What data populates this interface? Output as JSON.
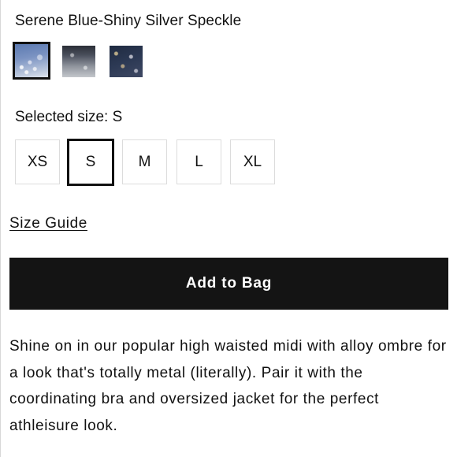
{
  "product": {
    "color_name": "Serene Blue-Shiny Silver Speckle",
    "swatches": [
      {
        "name": "Serene Blue-Shiny Silver Speckle",
        "selected": true,
        "color": "#7b93c2"
      },
      {
        "name": "",
        "selected": false,
        "color": "#6a6f7a"
      },
      {
        "name": "",
        "selected": false,
        "color": "#2c3954"
      }
    ],
    "selected_size_label": "Selected size: S",
    "sizes": [
      {
        "label": "XS",
        "selected": false
      },
      {
        "label": "S",
        "selected": true
      },
      {
        "label": "M",
        "selected": false
      },
      {
        "label": "L",
        "selected": false
      },
      {
        "label": "XL",
        "selected": false
      }
    ],
    "size_guide_label": "Size Guide",
    "add_to_bag_label": "Add to Bag",
    "description": "Shine on in our popular high waisted midi with alloy ombre for a look that's totally metal (literally). Pair it with the coordinating bra and oversized jacket for the perfect athleisure look."
  },
  "colors": {
    "button_bg": "#141414",
    "button_text": "#ffffff",
    "border_light": "#dcdcdc",
    "selected_border": "#111111"
  }
}
